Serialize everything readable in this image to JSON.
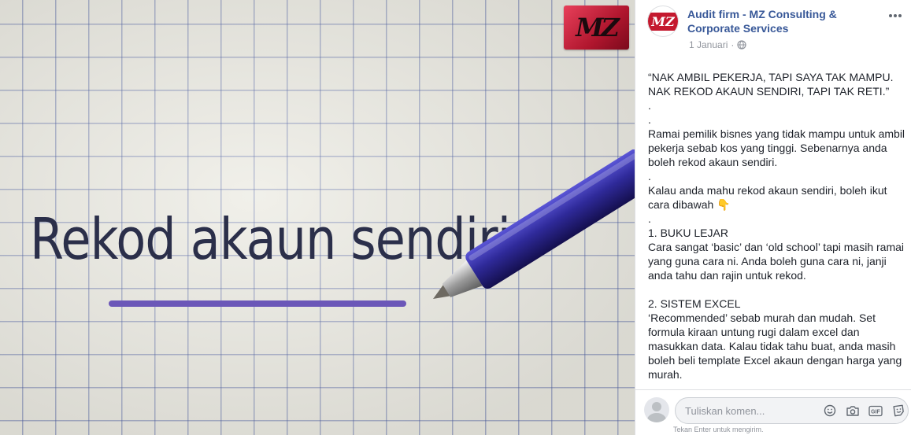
{
  "photo": {
    "handwritten_text": "Rekod akaun sendiri",
    "logo_text": "MZ"
  },
  "post": {
    "page_name": "Audit firm - MZ Consulting & Corporate Services",
    "avatar_text": "MZ",
    "date": "1 Januari",
    "separator": "·",
    "paragraphs": [
      "“NAK AMBIL PEKERJA, TAPI SAYA TAK MAMPU. NAK REKOD AKAUN SENDIRI, TAPI TAK RETI.”",
      ".",
      ".",
      "Ramai pemilik bisnes yang tidak mampu untuk ambil pekerja sebab kos yang tinggi. Sebenarnya anda boleh rekod akaun sendiri.",
      ".",
      "Kalau anda mahu rekod akaun sendiri, boleh ikut cara dibawah 👇",
      ".",
      "1. BUKU LEJAR",
      "Cara sangat ‘basic’ dan ‘old school’ tapi masih ramai yang guna cara ni. Anda boleh guna cara ni, janji anda tahu dan rajin untuk rekod.",
      "",
      "2. SISTEM EXCEL",
      "‘Recommended’ sebab murah dan mudah. Set formula kiraan untung rugi dalam excel dan masukkan data. Kalau tidak tahu buat, anda masih boleh beli template Excel akaun dengan harga yang murah.",
      "."
    ]
  },
  "comment": {
    "placeholder": "Tuliskan komen...",
    "hint": "Tekan Enter untuk mengirim.",
    "gif_label": "GIF"
  },
  "icons": {
    "more": "more-options-icon",
    "globe": "globe-icon",
    "emoji": "emoji-icon",
    "camera": "camera-icon",
    "gif": "gif-icon",
    "sticker": "sticker-icon"
  },
  "colors": {
    "link": "#385898",
    "pen": "#2e2a8c",
    "underline": "#6b57b8",
    "logo": "#c4192f"
  }
}
